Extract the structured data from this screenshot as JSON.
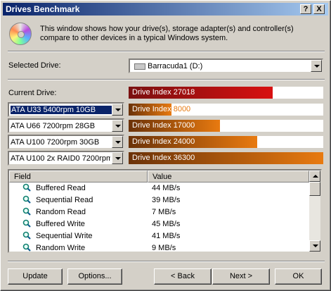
{
  "window": {
    "title": "Drives Benchmark",
    "help_button": "?",
    "close_button": "X"
  },
  "intro": {
    "icon": "cd-disc-icon",
    "text": "This window shows how your drive(s), storage adapter(s) and controller(s) compare to other devices in a typical Windows system."
  },
  "selected_drive": {
    "label": "Selected Drive:",
    "value": "Barracuda1 (D:)",
    "icon": "hard-drive-icon"
  },
  "current_drive": {
    "label": "Current Drive:",
    "bar_label": "Drive Index",
    "value": "27018",
    "fill_percent": 74,
    "color": "#d81010"
  },
  "comparisons": [
    {
      "device": "ATA U33 5400rpm 10GB",
      "bar_label": "Drive Index",
      "value": "8000",
      "fill_percent": 22,
      "selected": true
    },
    {
      "device": "ATA U66 7200rpm 28GB",
      "bar_label": "Drive Index",
      "value": "17000",
      "fill_percent": 47,
      "selected": false
    },
    {
      "device": "ATA U100 7200rpm 30GB",
      "bar_label": "Drive Index",
      "value": "24000",
      "fill_percent": 66,
      "selected": false
    },
    {
      "device": "ATA U100 2x RAID0 7200rpm",
      "bar_label": "Drive Index",
      "value": "36300",
      "fill_percent": 100,
      "selected": false
    }
  ],
  "comparison_color": "#e87a10",
  "results": {
    "columns": [
      "Field",
      "Value"
    ],
    "rows": [
      {
        "icon": "magnifier-icon",
        "field": "Buffered Read",
        "value": "44 MB/s"
      },
      {
        "icon": "magnifier-icon",
        "field": "Sequential Read",
        "value": "39 MB/s"
      },
      {
        "icon": "magnifier-icon",
        "field": "Random Read",
        "value": "7 MB/s"
      },
      {
        "icon": "magnifier-icon",
        "field": "Buffered Write",
        "value": "45 MB/s"
      },
      {
        "icon": "magnifier-icon",
        "field": "Sequential Write",
        "value": "41 MB/s"
      },
      {
        "icon": "magnifier-icon",
        "field": "Random Write",
        "value": "9 MB/s"
      }
    ]
  },
  "buttons": {
    "update": "Update",
    "options": "Options...",
    "back": "< Back",
    "next": "Next >",
    "ok": "OK"
  }
}
